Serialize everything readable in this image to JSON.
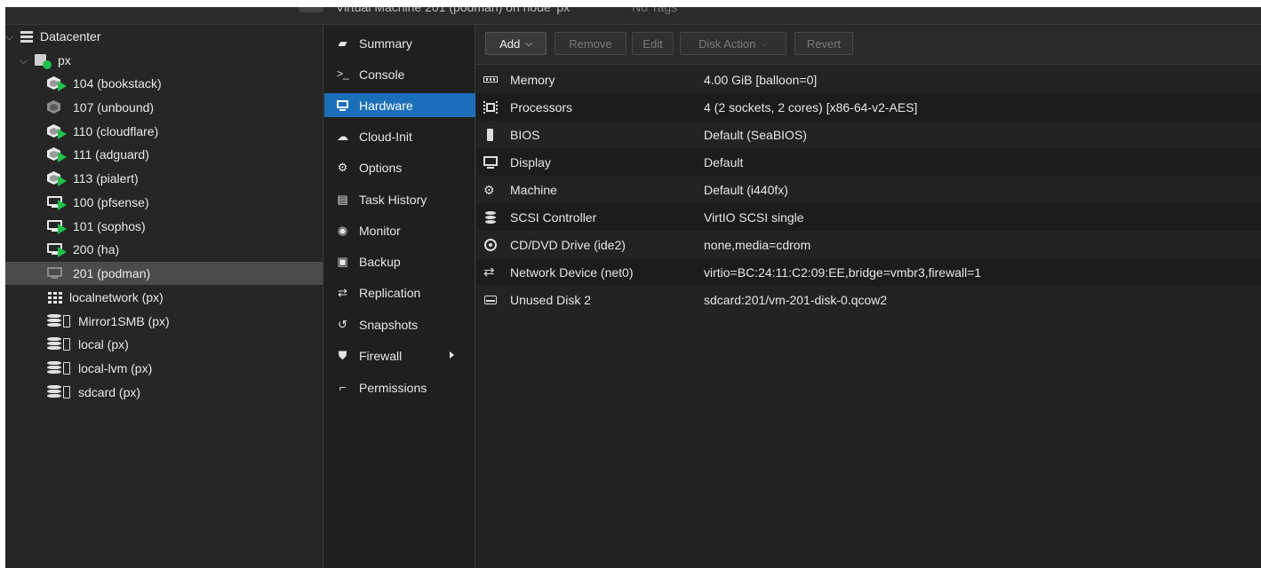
{
  "header": {
    "breadcrumb": "Virtual Machine 201 (podman) on node 'px'",
    "tags": "No Tags"
  },
  "tree": {
    "datacenter": "Datacenter",
    "node": "px",
    "items": [
      {
        "label": "104 (bookstack)",
        "icon": "container-running-icon"
      },
      {
        "label": "107 (unbound)",
        "icon": "container-stopped-icon"
      },
      {
        "label": "110 (cloudflare)",
        "icon": "container-running-icon"
      },
      {
        "label": "111 (adguard)",
        "icon": "container-running-icon"
      },
      {
        "label": "113 (pialert)",
        "icon": "container-running-icon"
      },
      {
        "label": "100 (pfsense)",
        "icon": "vm-running-icon"
      },
      {
        "label": "101 (sophos)",
        "icon": "vm-running-icon"
      },
      {
        "label": "200 (ha)",
        "icon": "vm-running-icon"
      },
      {
        "label": "201 (podman)",
        "icon": "vm-stopped-icon",
        "selected": true
      },
      {
        "label": "localnetwork (px)",
        "icon": "sdn-icon"
      },
      {
        "label": "Mirror1SMB (px)",
        "icon": "storage-icon"
      },
      {
        "label": "local (px)",
        "icon": "storage-icon"
      },
      {
        "label": "local-lvm (px)",
        "icon": "storage-icon"
      },
      {
        "label": "sdcard (px)",
        "icon": "storage-icon"
      }
    ]
  },
  "nav": {
    "items": [
      {
        "label": "Summary",
        "icon": "book-icon"
      },
      {
        "label": "Console",
        "icon": "terminal-icon"
      },
      {
        "label": "Hardware",
        "icon": "desktop-icon",
        "active": true
      },
      {
        "label": "Cloud-Init",
        "icon": "cloud-icon"
      },
      {
        "label": "Options",
        "icon": "gear-icon"
      },
      {
        "label": "Task History",
        "icon": "list-icon"
      },
      {
        "label": "Monitor",
        "icon": "eye-icon"
      },
      {
        "label": "Backup",
        "icon": "floppy-icon"
      },
      {
        "label": "Replication",
        "icon": "retweet-icon"
      },
      {
        "label": "Snapshots",
        "icon": "history-icon"
      },
      {
        "label": "Firewall",
        "icon": "shield-icon"
      },
      {
        "label": "Permissions",
        "icon": "unlock-icon"
      }
    ]
  },
  "toolbar": {
    "add": "Add",
    "remove": "Remove",
    "edit": "Edit",
    "disk_action": "Disk Action",
    "revert": "Revert"
  },
  "hardware": [
    {
      "key": "Memory",
      "value": "4.00 GiB [balloon=0]",
      "icon": "memory-icon"
    },
    {
      "key": "Processors",
      "value": "4 (2 sockets, 2 cores) [x86-64-v2-AES]",
      "icon": "cpu-icon"
    },
    {
      "key": "BIOS",
      "value": "Default (SeaBIOS)",
      "icon": "microchip-icon"
    },
    {
      "key": "Display",
      "value": "Default",
      "icon": "desktop-icon"
    },
    {
      "key": "Machine",
      "value": "Default (i440fx)",
      "icon": "cogs-icon"
    },
    {
      "key": "SCSI Controller",
      "value": "VirtIO SCSI single",
      "icon": "database-icon"
    },
    {
      "key": "CD/DVD Drive (ide2)",
      "value": "none,media=cdrom",
      "icon": "cdrom-icon"
    },
    {
      "key": "Network Device (net0)",
      "value": "virtio=BC:24:11:C2:09:EE,bridge=vmbr3,firewall=1",
      "icon": "exchange-icon"
    },
    {
      "key": "Unused Disk 2",
      "value": "sdcard:201/vm-201-disk-0.qcow2",
      "icon": "hdd-icon"
    }
  ],
  "colors": {
    "accent": "#1b6fb8",
    "running": "#21bf4b",
    "background": "#242424"
  }
}
